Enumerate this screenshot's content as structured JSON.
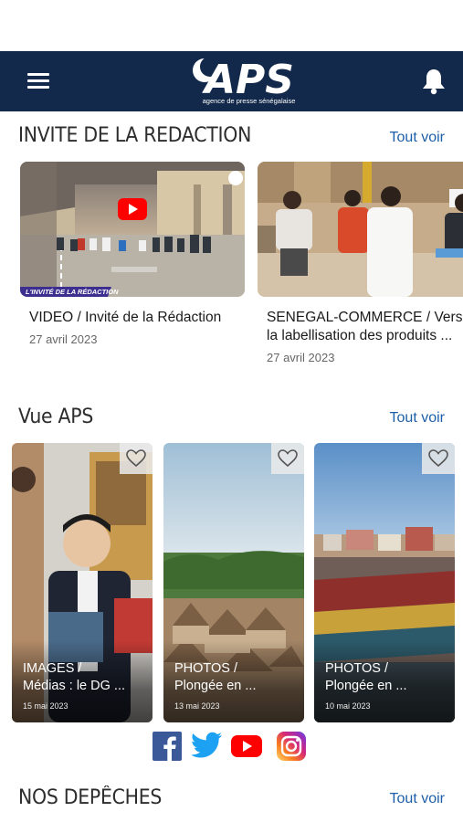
{
  "header": {
    "logo_text": "APS",
    "logo_tagline": "agence de presse sénégalaise"
  },
  "invite_section": {
    "title": "INVITE DE LA REDACTION",
    "see_all": "Tout voir",
    "cards": [
      {
        "title": "VIDEO / Invité de la Rédaction",
        "date": "27 avril 2023",
        "thumb_banner": "L'INVITÉ DE LA RÉDACTION"
      },
      {
        "title_line1": "SENEGAL-COMMERCE / Vers",
        "title_line2": "la labellisation des produits ...",
        "date": "27 avril 2023"
      }
    ]
  },
  "vue_section": {
    "title": "Vue APS",
    "see_all": "Tout voir",
    "cards": [
      {
        "title_line1": "IMAGES /",
        "title_line2": "Médias : le DG ...",
        "date": "15 mai 2023"
      },
      {
        "title_line1": "PHOTOS /",
        "title_line2": "Plongée en ...",
        "date": "13 mai 2023"
      },
      {
        "title_line1": "PHOTOS /",
        "title_line2": "Plongée en ...",
        "date": "10 mai 2023"
      }
    ]
  },
  "depeches_section": {
    "title": "NOS DEPÊCHES",
    "see_all": "Tout voir"
  },
  "colors": {
    "header_bg": "#13294b",
    "link": "#1d5fa8",
    "facebook": "#3b5998",
    "twitter": "#1da1f2",
    "youtube": "#ff0000"
  },
  "icons": [
    "menu-icon",
    "bell-icon",
    "heart-icon",
    "play-icon",
    "facebook-icon",
    "twitter-icon",
    "youtube-icon",
    "instagram-icon"
  ]
}
